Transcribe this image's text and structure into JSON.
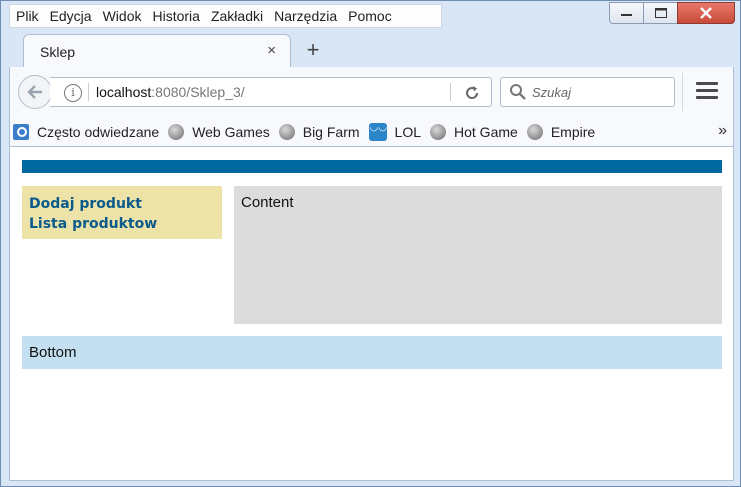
{
  "menubar": [
    "Plik",
    "Edycja",
    "Widok",
    "Historia",
    "Zakładki",
    "Narzędzia",
    "Pomoc"
  ],
  "tab": {
    "title": "Sklep",
    "close": "×",
    "new_tab": "+"
  },
  "navbar": {
    "url_host": "localhost",
    "url_rest": ":8080/Sklep_3/",
    "search_placeholder": "Szukaj",
    "info_glyph": "i"
  },
  "bookmarks": [
    {
      "label": "Często odwiedzane",
      "icon": "frequent-icon"
    },
    {
      "label": "Web Games",
      "icon": "globe-icon"
    },
    {
      "label": "Big Farm",
      "icon": "globe-icon"
    },
    {
      "label": "LOL",
      "icon": "lol-icon"
    },
    {
      "label": "Hot Game",
      "icon": "globe-icon"
    },
    {
      "label": "Empire",
      "icon": "globe-icon"
    }
  ],
  "bookmarks_more": "»",
  "page": {
    "sidebar": [
      "Dodaj produkt",
      "Lista produktow"
    ],
    "content": "Content",
    "bottom": "Bottom"
  },
  "colors": {
    "header": "#0068a0",
    "sidebar_bg": "#ede3a8",
    "content_bg": "#dcdcdc",
    "bottom_bg": "#c3dff0",
    "link": "#0a5a8c"
  }
}
